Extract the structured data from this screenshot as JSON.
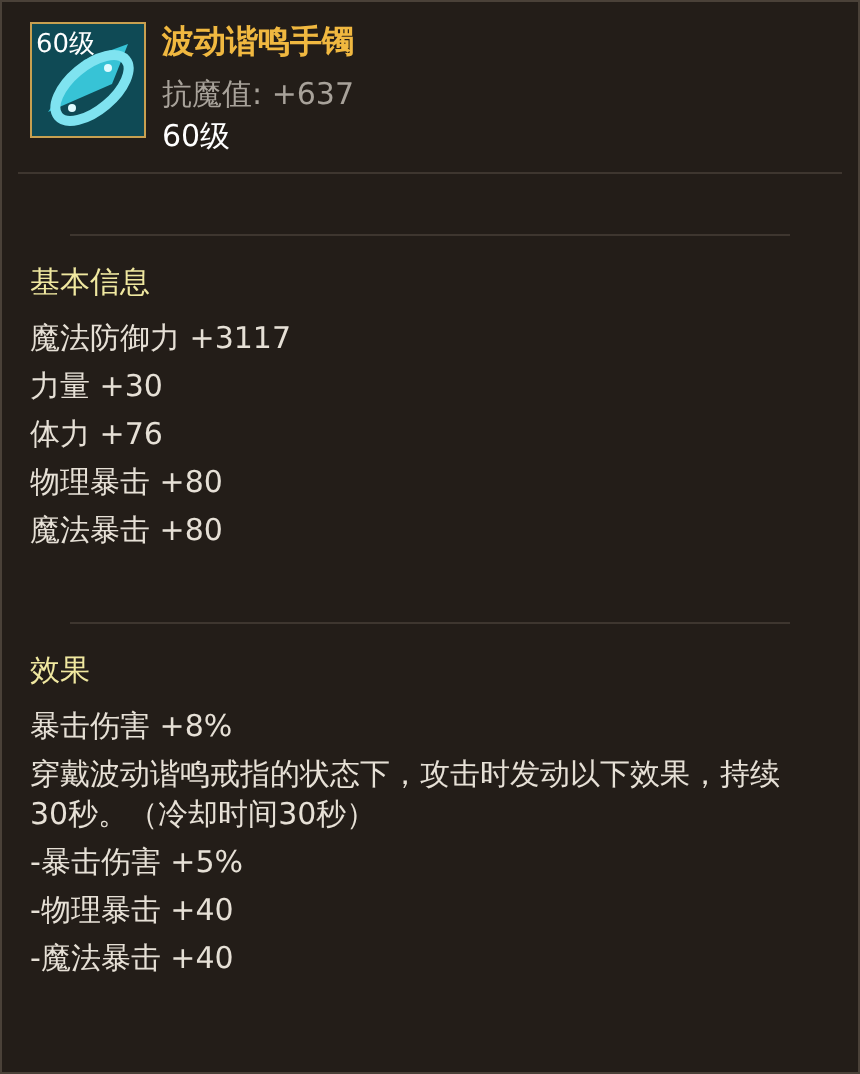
{
  "item": {
    "level_badge": "60级",
    "name": "波动谐鸣手镯",
    "resist": "抗魔值: +637",
    "level": "60级"
  },
  "sections": [
    {
      "title": "基本信息",
      "lines": [
        "魔法防御力 +3117",
        "力量 +30",
        "体力 +76",
        "物理暴击 +80",
        "魔法暴击 +80"
      ]
    },
    {
      "title": "效果",
      "lines": [
        "暴击伤害 +8%",
        "穿戴波动谐鸣戒指的状态下，攻击时发动以下效果，持续30秒。（冷却时间30秒）",
        "-暴击伤害 +5%",
        "-物理暴击 +40",
        "-魔法暴击 +40"
      ]
    }
  ]
}
